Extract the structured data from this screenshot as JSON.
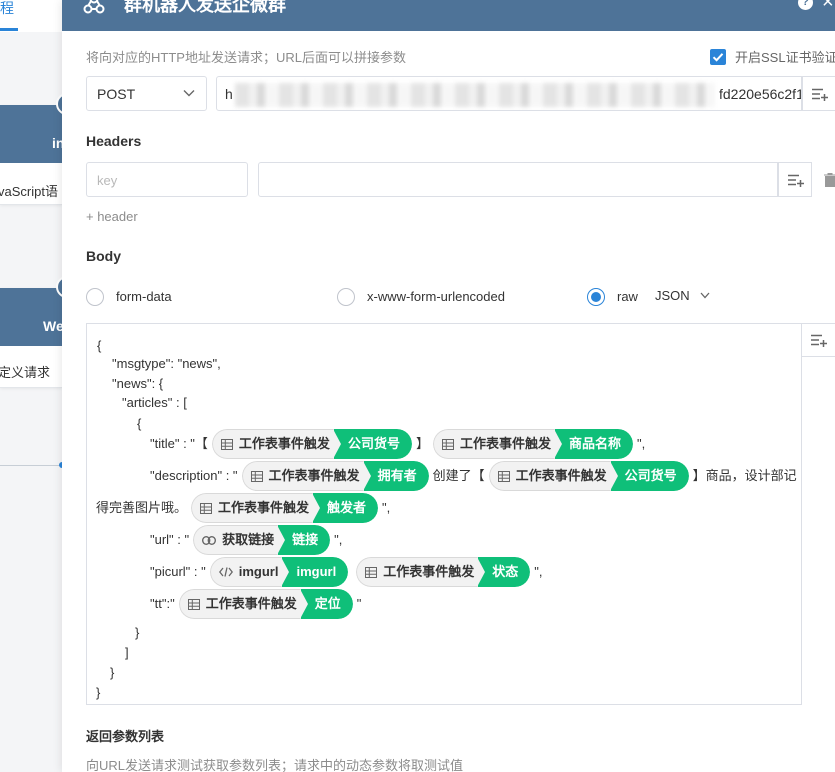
{
  "background": {
    "tab_label": "程",
    "node1": {
      "title": "in",
      "subtitle": "vaScript语"
    },
    "node2": {
      "title": "We",
      "subtitle": "定义请求"
    }
  },
  "modal": {
    "title": "群机器人发送企微群",
    "help": "?",
    "close": "×",
    "hint": "将向对应的HTTP地址发送请求；URL后面可以拼接参数",
    "ssl_label": "开启SSL证书验证",
    "ssl_checked": true,
    "method": "POST",
    "url_start": "h",
    "url_end": "fd220e56c2f1",
    "headers_title": "Headers",
    "key_placeholder": "key",
    "add_header": "+ header",
    "body_title": "Body",
    "body_types": [
      "form-data",
      "x-www-form-urlencoded",
      "raw"
    ],
    "body_selected": "raw",
    "raw_format": "JSON",
    "return_title": "返回参数列表",
    "return_hint": "向URL发送请求测试获取参数列表；请求中的动态参数将取测试值"
  },
  "editor": {
    "l1": "{",
    "l2": "\"msgtype\": \"news\",",
    "l3": "\"news\": {",
    "l4": "\"articles\" : [",
    "l5": "{",
    "l6_a": "\"title\" : \"【",
    "l6_b": "】",
    "l6_c": "\",",
    "l7_a": "\"description\" : \"",
    "l7_b": "创建了【",
    "l7_c": "】商品，设计部记",
    "l8_a": "得完善图片哦。",
    "l8_b": "\",",
    "l9_a": "\"url\" : \"",
    "l9_b": "\",",
    "l10_a": "\"picurl\" : \"",
    "l10_b": "\",",
    "l11_a": "\"tt\":\"",
    "l11_b": "\"",
    "l12": "}",
    "l13": "]",
    "l14": "}",
    "l15": "}"
  },
  "chips": {
    "title_1": {
      "source": "工作表事件触发",
      "field": "公司货号",
      "icon": "table-icon"
    },
    "title_2": {
      "source": "工作表事件触发",
      "field": "商品名称",
      "icon": "table-icon"
    },
    "desc_1": {
      "source": "工作表事件触发",
      "field": "拥有者",
      "icon": "table-icon"
    },
    "desc_2": {
      "source": "工作表事件触发",
      "field": "公司货号",
      "icon": "table-icon"
    },
    "desc_3": {
      "source": "工作表事件触发",
      "field": "触发者",
      "icon": "table-icon"
    },
    "url_1": {
      "source": "获取链接",
      "field": "链接",
      "icon": "link-icon"
    },
    "pic_1": {
      "source": "imgurl",
      "field": "imgurl",
      "icon": "code-icon"
    },
    "pic_2": {
      "source": "工作表事件触发",
      "field": "状态",
      "icon": "table-icon"
    },
    "tt_1": {
      "source": "工作表事件触发",
      "field": "定位",
      "icon": "table-icon"
    }
  },
  "colors": {
    "header": "#4e7398",
    "accent": "#2a84d8",
    "chip_green": "#0fbf79"
  }
}
